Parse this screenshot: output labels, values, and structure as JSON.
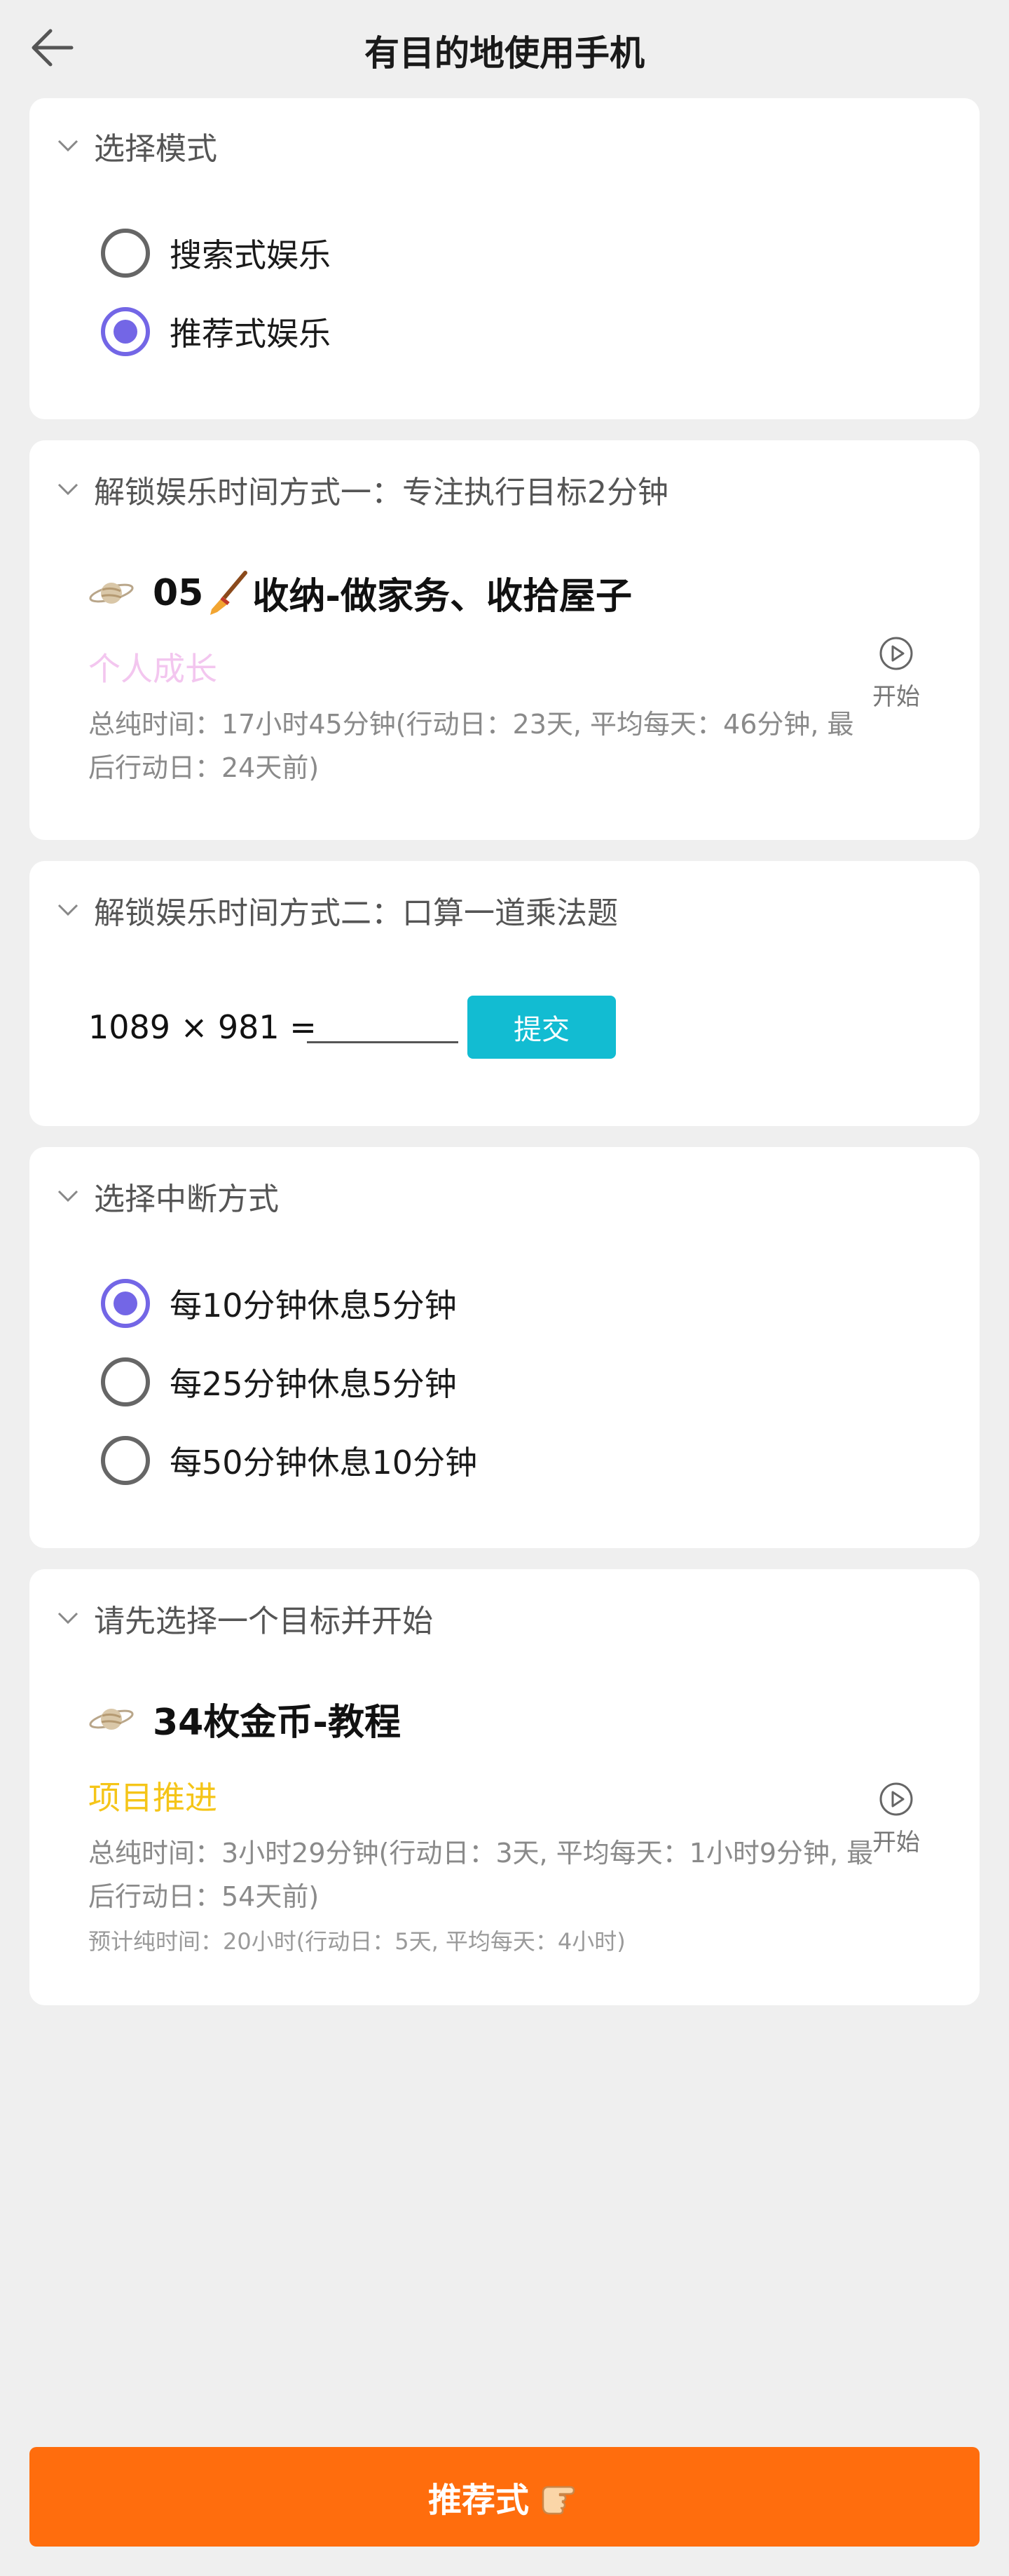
{
  "header": {
    "title": "有目的地使用手机"
  },
  "mode_card": {
    "title": "选择模式",
    "options": [
      {
        "label": "搜索式娱乐",
        "selected": false
      },
      {
        "label": "推荐式娱乐",
        "selected": true
      }
    ]
  },
  "unlock_one": {
    "title": "解锁娱乐时间方式一：专注执行目标2分钟",
    "goal": {
      "title_prefix": "05",
      "title_suffix": "收纳-做家务、收拾屋子",
      "category": "个人成长",
      "category_color": "#f3c6ef",
      "stats": "总纯时间：17小时45分钟(行动日：23天, 平均每天：46分钟, 最后行动日：24天前)",
      "start_label": "开始"
    }
  },
  "unlock_two": {
    "title": "解锁娱乐时间方式二：口算一道乘法题",
    "expression": "1089 × 981 =",
    "answer_value": "",
    "submit_label": "提交"
  },
  "interrupt_card": {
    "title": "选择中断方式",
    "options": [
      {
        "label": "每10分钟休息5分钟",
        "selected": true
      },
      {
        "label": "每25分钟休息5分钟",
        "selected": false
      },
      {
        "label": "每50分钟休息10分钟",
        "selected": false
      }
    ]
  },
  "choose_goal": {
    "title": "请先选择一个目标并开始",
    "goal": {
      "title": "34枚金币-教程",
      "category": "项目推进",
      "category_color": "#f5c518",
      "stats": "总纯时间：3小时29分钟(行动日：3天, 平均每天：1小时9分钟, 最后行动日：54天前)",
      "estimate": "预计纯时间：20小时(行动日：5天, 平均每天：4小时)",
      "start_label": "开始"
    }
  },
  "bottom_button": {
    "label": "推荐式"
  },
  "colors": {
    "accent_radio": "#7366e6",
    "submit": "#12bcd2",
    "bottom_button": "#ff6d0d"
  }
}
